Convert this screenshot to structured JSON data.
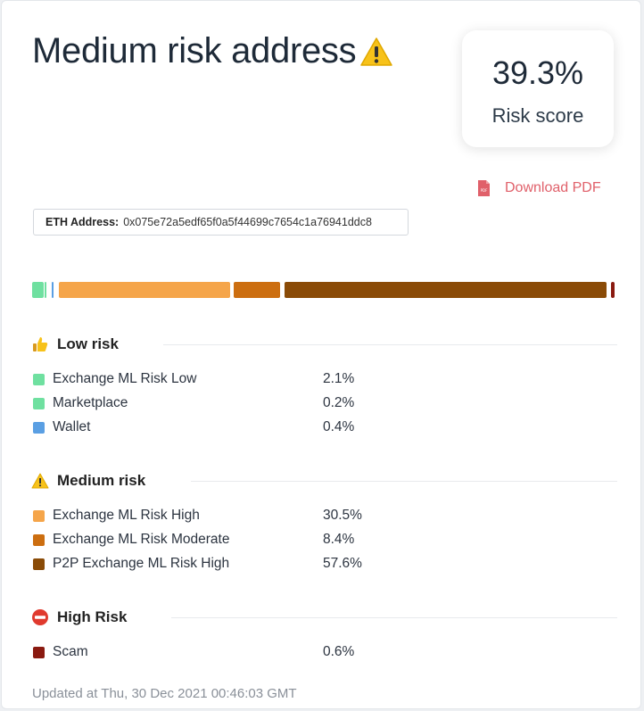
{
  "header": {
    "title": "Medium risk address",
    "title_icon": "warning-icon"
  },
  "score": {
    "value": "39.3%",
    "label": "Risk score"
  },
  "download": {
    "label": "Download PDF",
    "icon": "pdf-icon"
  },
  "eth": {
    "label": "ETH Address:",
    "address": "0x075e72a5edf65f0a5f44699c7654c1a76941ddc8"
  },
  "sections": {
    "low": {
      "title": "Low risk",
      "icon": "thumbs-up-icon",
      "items": [
        {
          "label": "Exchange ML Risk Low",
          "percent": "2.1%",
          "color": "#6fe0a0"
        },
        {
          "label": "Marketplace",
          "percent": "0.2%",
          "color": "#6fe0a0"
        },
        {
          "label": "Wallet",
          "percent": "0.4%",
          "color": "#5a9fe3"
        }
      ]
    },
    "medium": {
      "title": "Medium risk",
      "icon": "warning-icon",
      "items": [
        {
          "label": "Exchange ML Risk High",
          "percent": "30.5%",
          "color": "#f5a54a"
        },
        {
          "label": "Exchange ML Risk Moderate",
          "percent": "8.4%",
          "color": "#cc6e10"
        },
        {
          "label": "P2P Exchange ML Risk High",
          "percent": "57.6%",
          "color": "#8a4b07"
        }
      ]
    },
    "high": {
      "title": "High Risk",
      "icon": "no-entry-icon",
      "items": [
        {
          "label": "Scam",
          "percent": "0.6%",
          "color": "#8a1a10"
        }
      ]
    }
  },
  "footer": {
    "updated": "Updated at Thu, 30 Dec 2021 00:46:03 GMT"
  }
}
